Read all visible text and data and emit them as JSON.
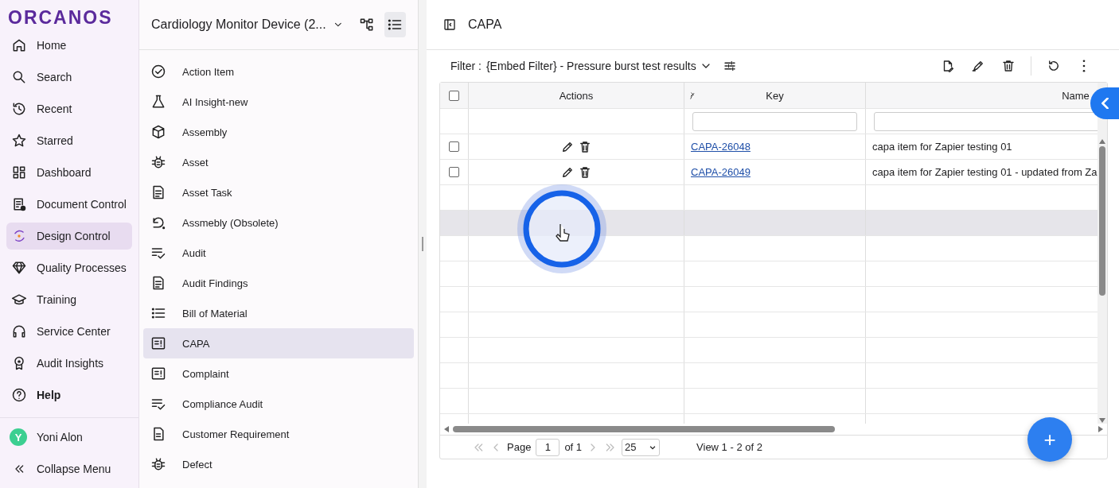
{
  "logo": "ORCANOS",
  "nav": [
    {
      "label": "Home",
      "selected": false
    },
    {
      "label": "Search",
      "selected": false
    },
    {
      "label": "Recent",
      "selected": false
    },
    {
      "label": "Starred",
      "selected": false
    },
    {
      "label": "Dashboard",
      "selected": false
    },
    {
      "label": "Document Control",
      "selected": false
    },
    {
      "label": "Design Control",
      "selected": true
    },
    {
      "label": "Quality Processes",
      "selected": false
    },
    {
      "label": "Training",
      "selected": false
    },
    {
      "label": "Service Center",
      "selected": false
    },
    {
      "label": "Audit Insights",
      "selected": false
    },
    {
      "label": "Help",
      "selected": false
    }
  ],
  "user": {
    "initial": "Y",
    "name": "Yoni Alon"
  },
  "collapse": "Collapse Menu",
  "project": {
    "title": "Cardiology Monitor Device (2...",
    "view_buttons": [
      {
        "selected": false
      },
      {
        "selected": true
      }
    ]
  },
  "entities": [
    {
      "label": "Action Item",
      "selected": false
    },
    {
      "label": "AI Insight-new",
      "selected": false
    },
    {
      "label": "Assembly",
      "selected": false
    },
    {
      "label": "Asset",
      "selected": false
    },
    {
      "label": "Asset Task",
      "selected": false
    },
    {
      "label": "Assmebly (Obsolete)",
      "selected": false
    },
    {
      "label": "Audit",
      "selected": false
    },
    {
      "label": "Audit Findings",
      "selected": false
    },
    {
      "label": "Bill of Material",
      "selected": false
    },
    {
      "label": "CAPA",
      "selected": true
    },
    {
      "label": "Complaint",
      "selected": false
    },
    {
      "label": "Compliance Audit",
      "selected": false
    },
    {
      "label": "Customer Requirement",
      "selected": false
    },
    {
      "label": "Defect",
      "selected": false
    }
  ],
  "page_title": "CAPA",
  "filter": {
    "label": "Filter :",
    "value": "{Embed Filter} - Pressure burst test results"
  },
  "table": {
    "all_checked": false,
    "columns": [
      "Actions",
      "Key",
      "Name"
    ],
    "rows": [
      {
        "checked": false,
        "key": "CAPA-26048",
        "name": "capa item for Zapier testing 01"
      },
      {
        "checked": false,
        "key": "CAPA-26049",
        "name": "capa item for Zapier testing 01 - updated from Za"
      }
    ],
    "blank_rows": [
      {
        "highlighted": false
      },
      {
        "highlighted": true
      },
      {
        "highlighted": false
      },
      {
        "highlighted": false
      },
      {
        "highlighted": false
      },
      {
        "highlighted": false
      },
      {
        "highlighted": false
      },
      {
        "highlighted": false
      },
      {
        "highlighted": false
      },
      {
        "highlighted": false
      }
    ]
  },
  "pager": {
    "page_label": "Page",
    "page": "1",
    "of": "of 1",
    "page_size": "25",
    "view": "View 1 - 2 of 2"
  },
  "fab": "+"
}
